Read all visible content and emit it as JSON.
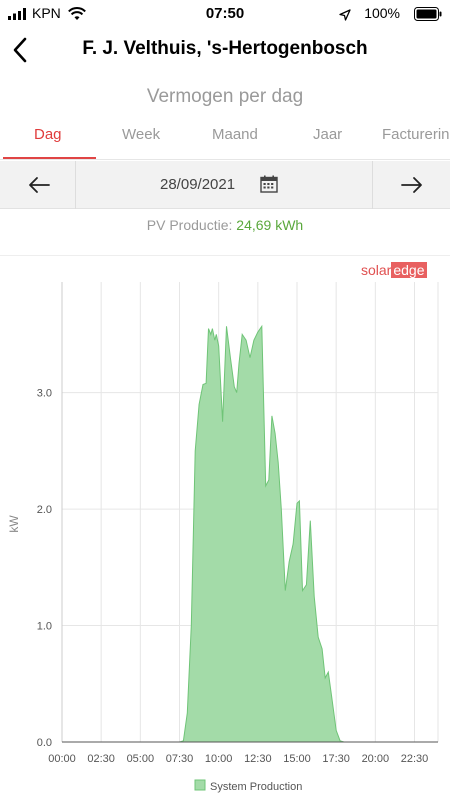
{
  "status_bar": {
    "carrier": "KPN",
    "time": "07:50",
    "battery": "100%"
  },
  "header": {
    "title": "F. J. Velthuis, 's-Hertogenbosch"
  },
  "card": {
    "title": "Vermogen per dag"
  },
  "tabs": [
    {
      "label": "Dag",
      "active": true
    },
    {
      "label": "Week",
      "active": false
    },
    {
      "label": "Maand",
      "active": false
    },
    {
      "label": "Jaar",
      "active": false
    },
    {
      "label": "Facturering",
      "active": false
    }
  ],
  "date_nav": {
    "date": "28/09/2021"
  },
  "production": {
    "label": "PV Productie:",
    "value": "24,69 kWh"
  },
  "logo": {
    "part1": "solar",
    "part2": "edge"
  },
  "colors": {
    "accent": "#e04545",
    "series_fill": "#a3dba8",
    "series_stroke": "#6fc477",
    "production_value": "#5aa83c"
  },
  "chart_data": {
    "type": "area",
    "ylabel": "kW",
    "xlim": [
      0,
      24
    ],
    "ylim": [
      0,
      3.95
    ],
    "y_ticks": [
      0,
      1.0,
      2.0,
      3.0
    ],
    "y_tick_labels": [
      "0.0",
      "1.0",
      "2.0",
      "3.0"
    ],
    "x_tick_hours": [
      0,
      2.5,
      5,
      7.5,
      10,
      12.5,
      15,
      17.5,
      20,
      22.5
    ],
    "x_tick_labels": [
      "00:00",
      "02:30",
      "05:00",
      "07:30",
      "10:00",
      "12:30",
      "15:00",
      "17:30",
      "20:00",
      "22:30"
    ],
    "grid": true,
    "legend_position": "bottom",
    "series": [
      {
        "name": "System Production",
        "points": [
          [
            0,
            0
          ],
          [
            7.5,
            0
          ],
          [
            7.75,
            0.01
          ],
          [
            8.0,
            0.25
          ],
          [
            8.25,
            1.0
          ],
          [
            8.5,
            2.5
          ],
          [
            8.75,
            2.9
          ],
          [
            9.0,
            3.07
          ],
          [
            9.2,
            3.08
          ],
          [
            9.35,
            3.55
          ],
          [
            9.5,
            3.5
          ],
          [
            9.6,
            3.55
          ],
          [
            9.75,
            3.45
          ],
          [
            9.85,
            3.5
          ],
          [
            10.0,
            3.4
          ],
          [
            10.25,
            2.75
          ],
          [
            10.5,
            3.57
          ],
          [
            10.75,
            3.3
          ],
          [
            11.0,
            3.05
          ],
          [
            11.15,
            3.0
          ],
          [
            11.3,
            3.25
          ],
          [
            11.5,
            3.5
          ],
          [
            11.75,
            3.45
          ],
          [
            12.0,
            3.3
          ],
          [
            12.25,
            3.45
          ],
          [
            12.5,
            3.52
          ],
          [
            12.75,
            3.57
          ],
          [
            13.0,
            2.2
          ],
          [
            13.2,
            2.25
          ],
          [
            13.4,
            2.8
          ],
          [
            13.6,
            2.65
          ],
          [
            13.8,
            2.4
          ],
          [
            14.0,
            2.0
          ],
          [
            14.25,
            1.3
          ],
          [
            14.5,
            1.55
          ],
          [
            14.75,
            1.7
          ],
          [
            15.0,
            2.05
          ],
          [
            15.15,
            2.07
          ],
          [
            15.35,
            1.3
          ],
          [
            15.6,
            1.35
          ],
          [
            15.85,
            1.9
          ],
          [
            16.1,
            1.25
          ],
          [
            16.35,
            0.9
          ],
          [
            16.6,
            0.8
          ],
          [
            16.8,
            0.55
          ],
          [
            17.0,
            0.6
          ],
          [
            17.2,
            0.4
          ],
          [
            17.5,
            0.1
          ],
          [
            17.75,
            0.01
          ],
          [
            18.0,
            0
          ],
          [
            24,
            0
          ]
        ]
      }
    ]
  }
}
